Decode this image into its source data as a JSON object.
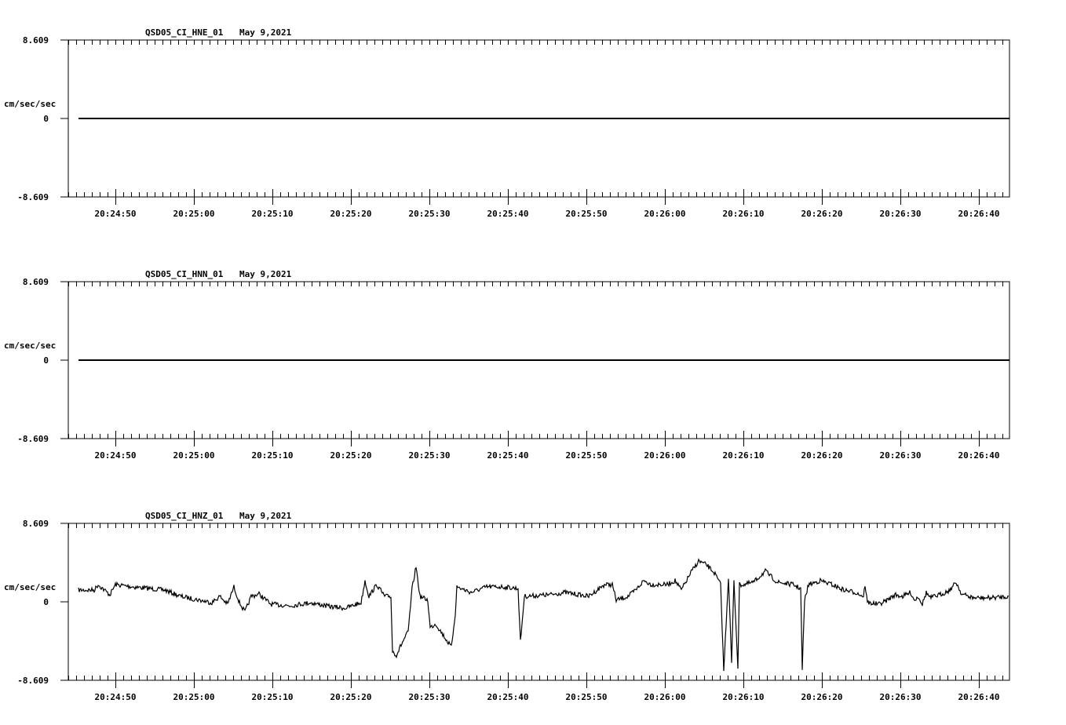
{
  "chart_data": [
    {
      "type": "line",
      "title": "QSD05_CI_HNE_01",
      "date": "May 9,2021",
      "ylabel": "cm/sec/sec",
      "y_tick_labels": [
        "8.609",
        "0",
        "-8.609"
      ],
      "ylim": [
        -8.609,
        8.609
      ],
      "xlim_seconds_after_20_24_00": [
        44,
        163.9
      ],
      "x_tick_labels": [
        "20:24:50",
        "20:25:00",
        "20:25:10",
        "20:25:20",
        "20:25:30",
        "20:25:40",
        "20:25:50",
        "20:26:00",
        "20:26:10",
        "20:26:20",
        "20:26:30",
        "20:26:40"
      ],
      "series": [
        {
          "name": "HNE",
          "t": [
            45.3,
            163.9
          ],
          "values": [
            0,
            0
          ]
        }
      ]
    },
    {
      "type": "line",
      "title": "QSD05_CI_HNN_01",
      "date": "May 9,2021",
      "ylabel": "cm/sec/sec",
      "y_tick_labels": [
        "8.609",
        "0",
        "-8.609"
      ],
      "ylim": [
        -8.609,
        8.609
      ],
      "xlim_seconds_after_20_24_00": [
        44,
        163.9
      ],
      "x_tick_labels": [
        "20:24:50",
        "20:25:00",
        "20:25:10",
        "20:25:20",
        "20:25:30",
        "20:25:40",
        "20:25:50",
        "20:26:00",
        "20:26:10",
        "20:26:20",
        "20:26:30",
        "20:26:40"
      ],
      "series": [
        {
          "name": "HNN",
          "t": [
            45.3,
            163.9
          ],
          "values": [
            0,
            0
          ]
        }
      ]
    },
    {
      "type": "line",
      "title": "QSD05_CI_HNZ_01",
      "date": "May 9,2021",
      "ylabel": "cm/sec/sec",
      "y_tick_labels": [
        "8.609",
        "0",
        "-8.609"
      ],
      "ylim": [
        -8.609,
        8.609
      ],
      "xlim_seconds_after_20_24_00": [
        44,
        163.9
      ],
      "x_tick_labels": [
        "20:24:50",
        "20:25:00",
        "20:25:10",
        "20:25:20",
        "20:25:30",
        "20:25:40",
        "20:25:50",
        "20:26:00",
        "20:26:10",
        "20:26:20",
        "20:26:30",
        "20:26:40"
      ],
      "series": [
        {
          "name": "HNZ",
          "t": [
            45.3,
            47.3,
            47.8,
            49.3,
            50.0,
            52.3,
            56.3,
            58.3,
            60.8,
            62.3,
            63.3,
            64.3,
            65.1,
            65.8,
            66.5,
            67.3,
            68.3,
            69.8,
            72.3,
            74.8,
            77.3,
            79.3,
            81.3,
            81.8,
            82.3,
            83.3,
            84.3,
            85.1,
            85.3,
            85.8,
            86.5,
            87.3,
            87.8,
            88.3,
            88.8,
            89.8,
            90.1,
            90.8,
            91.8,
            92.8,
            93.3,
            93.5,
            95.3,
            97.3,
            99.3,
            101.3,
            101.6,
            102.1,
            105.3,
            107.3,
            110.3,
            112.3,
            113.3,
            113.8,
            115.3,
            116.3,
            117.3,
            118.3,
            120.3,
            121.3,
            122.1,
            123.3,
            124.3,
            125.3,
            126.3,
            127.1,
            127.5,
            128.1,
            128.5,
            128.8,
            129.3,
            129.5,
            130.1,
            131.3,
            132.8,
            134.3,
            136.3,
            137.3,
            137.5,
            137.8,
            138.3,
            139.8,
            141.3,
            142.8,
            144.3,
            145.3,
            145.5,
            145.8,
            147.3,
            148.3,
            149.3,
            150.3,
            151.3,
            151.8,
            152.3,
            152.8,
            153.3,
            153.8,
            155.3,
            156.3,
            157.1,
            157.8,
            159.3,
            161.3,
            163.8
          ],
          "values": [
            1.29,
            1.29,
            1.89,
            0.77,
            1.89,
            1.64,
            1.29,
            0.6,
            0.17,
            -0.09,
            0.6,
            -0.26,
            1.64,
            -0.09,
            -1.12,
            0.6,
            0.86,
            -0.26,
            -0.43,
            -0.09,
            -0.52,
            -0.69,
            -0.09,
            2.32,
            0.6,
            1.89,
            0.6,
            0.6,
            -5.42,
            -5.85,
            -4.56,
            -3.27,
            1.46,
            3.87,
            0.6,
            0.17,
            -2.84,
            -2.41,
            -3.7,
            -4.99,
            -1.29,
            1.64,
            1.03,
            1.64,
            1.64,
            1.46,
            -4.39,
            0.6,
            0.77,
            1.03,
            0.6,
            1.89,
            1.89,
            0.17,
            0.6,
            1.29,
            2.32,
            1.89,
            1.89,
            2.32,
            1.29,
            3.19,
            4.48,
            4.05,
            3.19,
            1.89,
            -7.58,
            2.75,
            -6.72,
            2.32,
            -7.15,
            1.89,
            1.89,
            2.15,
            3.36,
            2.15,
            1.89,
            1.46,
            -7.4,
            0.17,
            1.89,
            2.32,
            1.89,
            1.29,
            1.03,
            0.6,
            1.89,
            -0.09,
            -0.26,
            0.17,
            0.77,
            0.6,
            1.03,
            0.17,
            0.6,
            -0.26,
            1.03,
            0.43,
            0.86,
            1.29,
            2.15,
            0.86,
            0.43,
            0.43,
            0.6
          ]
        }
      ]
    }
  ]
}
